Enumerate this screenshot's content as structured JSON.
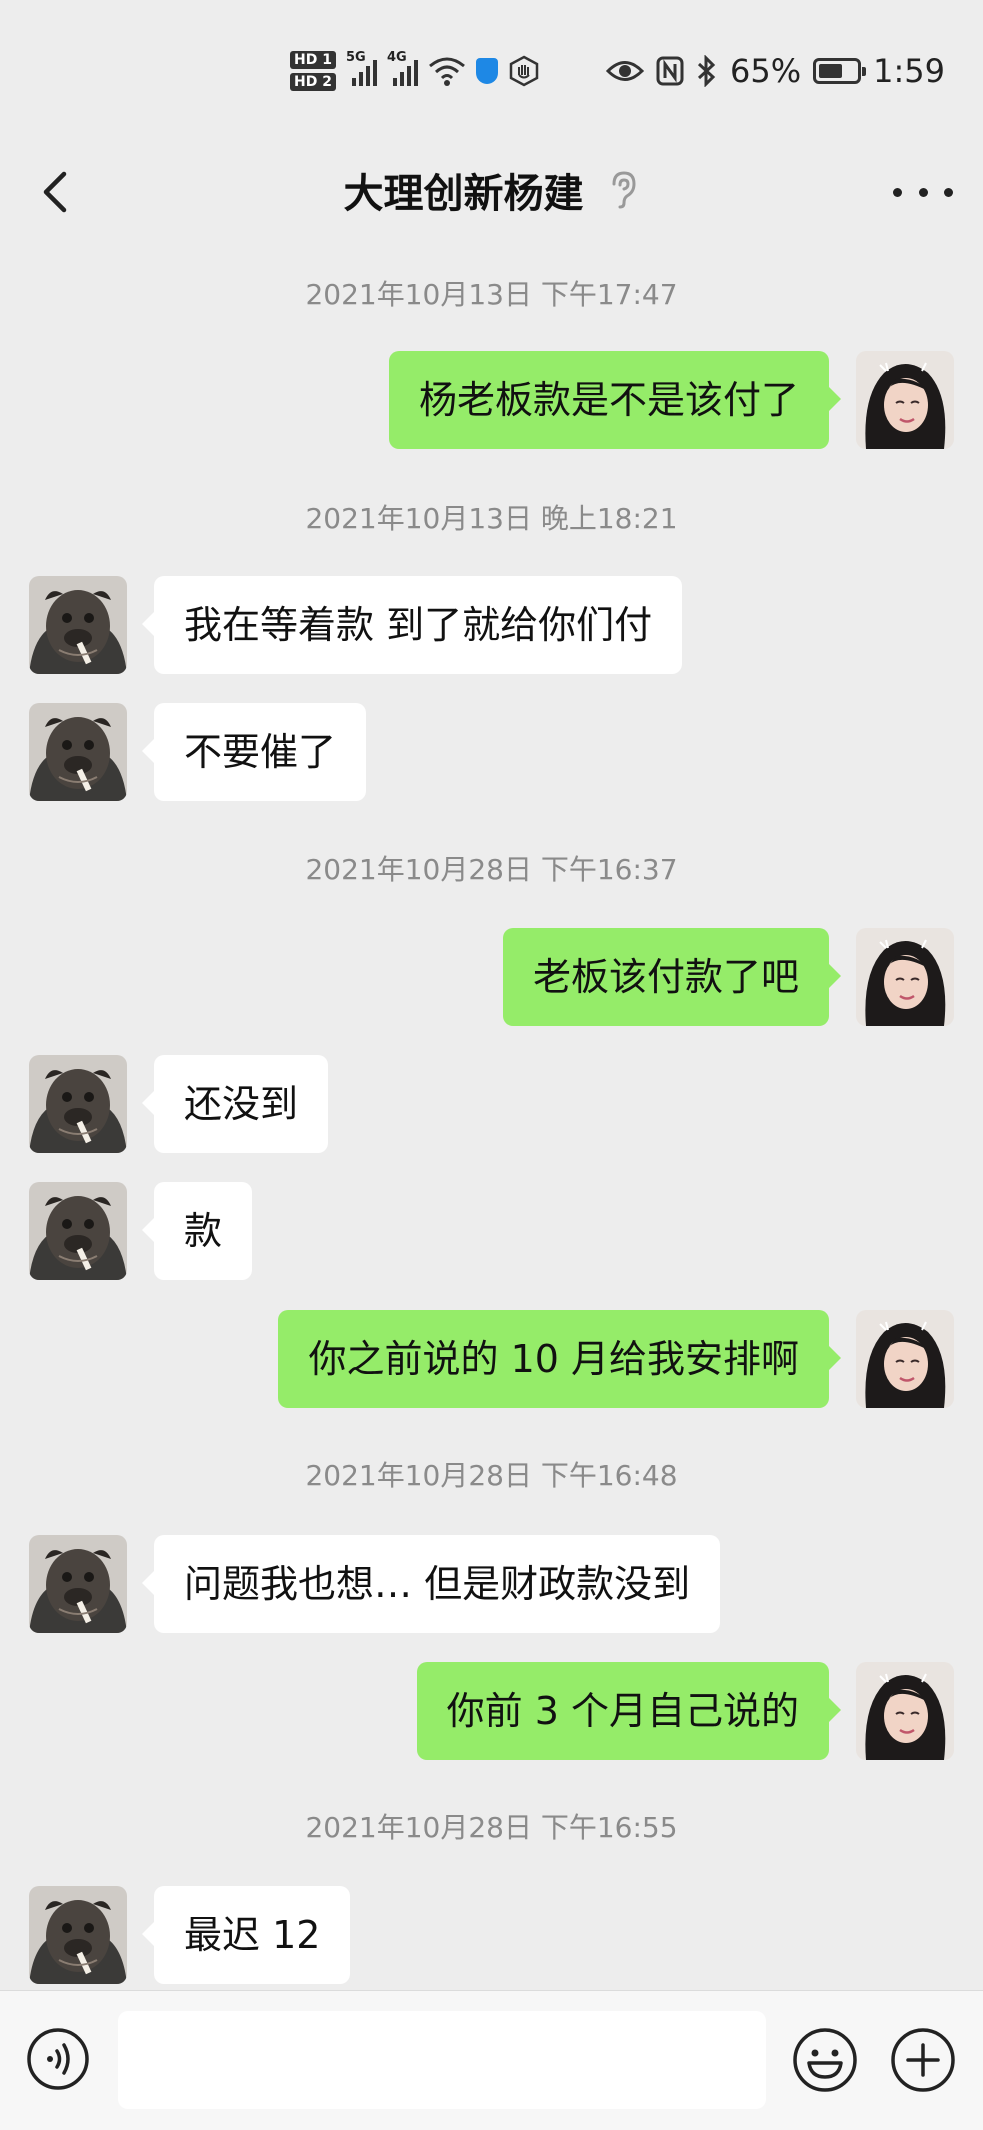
{
  "status_bar": {
    "hd1": "HD 1",
    "hd2": "HD 2",
    "net1": "5G",
    "net2": "4G",
    "battery_percent_text": "65%",
    "battery_level": 0.65,
    "time": "1:59"
  },
  "header": {
    "title": "大理创新杨建"
  },
  "messages": [
    {
      "type": "time",
      "text": "2021年10月13日 下午17:47"
    },
    {
      "type": "msg",
      "side": "right",
      "text": "杨老板款是不是该付了"
    },
    {
      "type": "time",
      "text": "2021年10月13日 晚上18:21"
    },
    {
      "type": "msg",
      "side": "left",
      "text": "我在等着款 到了就给你们付"
    },
    {
      "type": "msg",
      "side": "left",
      "text": "不要催了"
    },
    {
      "type": "time",
      "text": "2021年10月28日 下午16:37"
    },
    {
      "type": "msg",
      "side": "right",
      "text": "老板该付款了吧"
    },
    {
      "type": "msg",
      "side": "left",
      "text": "还没到"
    },
    {
      "type": "msg",
      "side": "left",
      "text": "款"
    },
    {
      "type": "msg",
      "side": "right",
      "text": "你之前说的 10 月给我安排啊"
    },
    {
      "type": "time",
      "text": "2021年10月28日 下午16:48"
    },
    {
      "type": "msg",
      "side": "left",
      "text": "问题我也想… 但是财政款没到"
    },
    {
      "type": "msg",
      "side": "right",
      "text": "你前 3 个月自己说的"
    },
    {
      "type": "time",
      "text": "2021年10月28日 下午16:55"
    },
    {
      "type": "msg",
      "side": "left",
      "text": "最迟 12"
    }
  ],
  "input": {
    "value": "",
    "placeholder": ""
  },
  "icons": {
    "back": "back-arrow-icon",
    "ear": "ear-icon",
    "more": "more-icon",
    "voice": "voice-icon",
    "emoji": "emoji-icon",
    "plus": "plus-icon"
  },
  "colors": {
    "background": "#ededed",
    "sent_bubble": "#95ec69",
    "received_bubble": "#ffffff",
    "timestamp": "#8a8a8a"
  }
}
